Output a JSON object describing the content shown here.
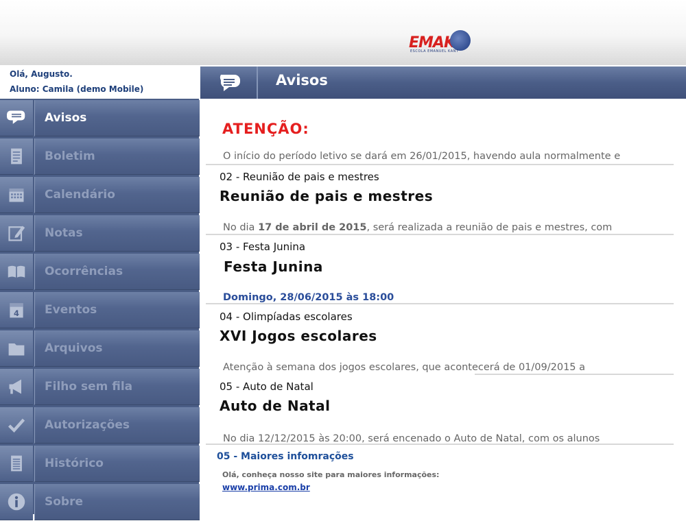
{
  "brand": {
    "logo_text": "EMAK",
    "logo_subtitle": "ESCOLA EMANUEL KANT"
  },
  "user": {
    "greeting": "Olá, Augusto.",
    "student": "Aluno: Camila (demo Mobile)"
  },
  "header": {
    "title": "Avisos"
  },
  "sidebar": {
    "items": [
      {
        "label": "Avisos",
        "icon": "speech-bubble-icon",
        "active": true
      },
      {
        "label": "Boletim",
        "icon": "document-icon"
      },
      {
        "label": "Calendário",
        "icon": "calendar-icon"
      },
      {
        "label": "Notas",
        "icon": "pencil-note-icon"
      },
      {
        "label": "Ocorrências",
        "icon": "book-icon"
      },
      {
        "label": "Eventos",
        "icon": "date-icon"
      },
      {
        "label": "Arquivos",
        "icon": "folder-icon"
      },
      {
        "label": "Filho sem fila",
        "icon": "megaphone-icon"
      },
      {
        "label": "Autorizações",
        "icon": "checkmark-icon"
      },
      {
        "label": "Histórico",
        "icon": "list-document-icon"
      },
      {
        "label": "Sobre",
        "icon": "info-icon"
      }
    ]
  },
  "notices": {
    "n1": {
      "heading": "ATENÇÃO:",
      "text": "O início do período letivo se dará em 26/01/2015, havendo aula normalmente e"
    },
    "n2": {
      "title": "02 - Reunião de pais e mestres",
      "big": "Reunião de pais e mestres",
      "text_pre": "No dia ",
      "text_bold": "17 de abril de 2015",
      "text_post": ", será realizada a reunião de pais e mestres, com"
    },
    "n3": {
      "title": "03 - Festa Junina",
      "big": "Festa Junina",
      "text": "Domingo, 28/06/2015 às 18:00"
    },
    "n4": {
      "title": "04 - Olimpíadas escolares",
      "big": "XVI Jogos escolares",
      "text": "Atenção à semana dos jogos escolares, que acontecerá de 01/09/2015 a"
    },
    "n5": {
      "title": "05 - Auto de Natal",
      "big": "Auto de Natal",
      "text": "No dia 12/12/2015 às 20:00, será encenado o Auto de Natal, com os alunos"
    },
    "n6": {
      "title": "05 - Maiores infomrações",
      "text": "Olá, conheça nosso site para maiores informações:",
      "url": "www.prima.com.br"
    }
  },
  "colors": {
    "sidebar": "#4a5d85",
    "accent_red": "#e51f1f",
    "link_blue": "#1a3fa8"
  }
}
